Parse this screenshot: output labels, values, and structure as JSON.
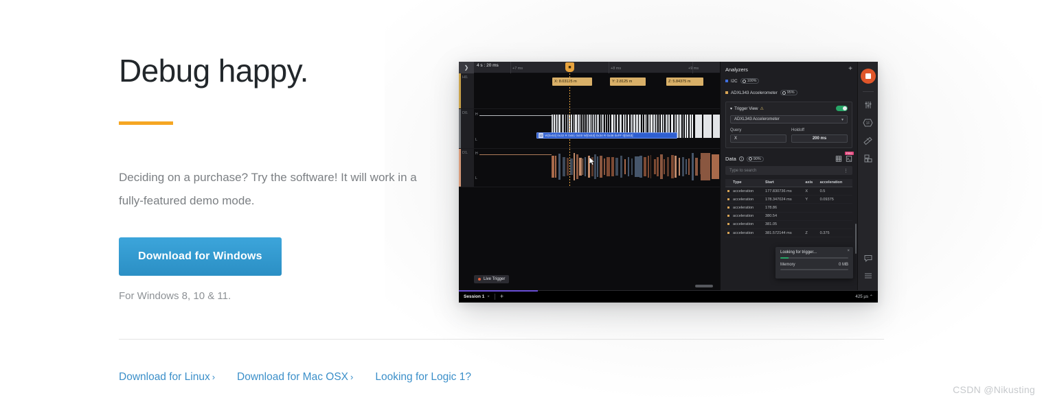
{
  "hero": {
    "title": "Debug happy.",
    "paragraph": "Deciding on a purchase? Try the software! It will work in a fully-featured demo mode.",
    "download_button": "Download for Windows",
    "sub_note": "For Windows 8, 10 & 11.",
    "accent_color": "#f5a623",
    "button_color": "#3ca5db"
  },
  "footer": {
    "links": [
      {
        "label": "Download for Linux",
        "chevron": "›"
      },
      {
        "label": "Download for Mac OSX",
        "chevron": "›"
      },
      {
        "label": "Looking for Logic 1?",
        "chevron": ""
      }
    ],
    "link_color": "#3b8fc9"
  },
  "watermark": "CSDN @Nikusting",
  "app": {
    "ruler": {
      "collapse_icon": "chevron-right-icon",
      "absolute_time": "4 s : 20 ms",
      "ticks": [
        "+7 ms",
        "+8 ms",
        "+9 ms"
      ],
      "trigger_icon": "trigger-marker-icon"
    },
    "lanes": [
      {
        "name": "H0.",
        "color": "#c9a24a",
        "level_high": "",
        "level_low": ""
      },
      {
        "name": "D0.",
        "color": "#8c8f94",
        "level_high": "H",
        "level_low": "L"
      },
      {
        "name": "D1.",
        "color": "#d79a7a",
        "level_high": "H",
        "level_low": "L"
      }
    ],
    "chips": [
      {
        "label": "X: 8.03125 m"
      },
      {
        "label": "Y: 2.8125 m"
      },
      {
        "label": "Z: 5.84375 m"
      }
    ],
    "i2c_bar": {
      "lead": "12",
      "text": "W[0x53] 0x32 R 0x61 0x00 W[0x53] 0x34 R 0x46 0xFF 0[0x53]"
    },
    "live_trigger": "Live Trigger",
    "analyzers": {
      "title": "Analyzers",
      "add_icon": "plus-icon",
      "items": [
        {
          "label": "I2C",
          "percent": "100%",
          "color": "#3f6fe0"
        },
        {
          "label": "ADXL343 Accelerometer",
          "percent": "95%",
          "color": "#d8a455"
        }
      ]
    },
    "trigger_view": {
      "title": "Trigger View",
      "warning_icon": "warning-icon",
      "collapse_icon": "chevron-down-icon",
      "toggle_on": true,
      "select_value": "ADXL343 Accelerometer",
      "query_label": "Query",
      "query_value": "X",
      "holdoff_label": "Holdoff",
      "holdoff_value": "200 ms"
    },
    "data": {
      "title": "Data",
      "info_icon": "info-icon",
      "percent": "90%",
      "grid_icon": "grid-icon",
      "terminal_icon": "terminal-icon",
      "pro_badge": "PRO",
      "search_placeholder": "Type to search",
      "kebab_icon": "more-options-icon",
      "columns": [
        "Type",
        "Start",
        "axis",
        "acceleration"
      ],
      "rows": [
        [
          "acceleration",
          "177.830736 ms",
          "X",
          "0.5"
        ],
        [
          "acceleration",
          "178.347024 ms",
          "Y",
          "0.09375"
        ],
        [
          "acceleration",
          "178.86",
          "",
          ""
        ],
        [
          "acceleration",
          "380.54",
          "",
          ""
        ],
        [
          "acceleration",
          "381.05",
          "",
          ""
        ],
        [
          "acceleration",
          "381.572144 ms",
          "Z",
          "0.375"
        ]
      ]
    },
    "toast": {
      "title": "Looking for trigger...",
      "close_icon": "close-icon",
      "progress_percent": 12,
      "memory_label": "Memory",
      "memory_value": "0 MB",
      "memory_percent": 0
    },
    "rail": [
      {
        "icon": "stop-record-icon"
      },
      {
        "icon": "sliders-icon"
      },
      {
        "icon": "frame-1f-icon",
        "label": "1F"
      },
      {
        "icon": "ruler-icon"
      },
      {
        "icon": "blocks-layout-icon"
      },
      {
        "icon": "chat-bubble-icon"
      },
      {
        "icon": "hamburger-menu-icon"
      }
    ],
    "session_bar": {
      "tab_label": "Session 1",
      "close_icon": "close-icon",
      "add_icon": "plus-icon",
      "right_label": "425 µs",
      "right_chevron": "⌃"
    }
  }
}
